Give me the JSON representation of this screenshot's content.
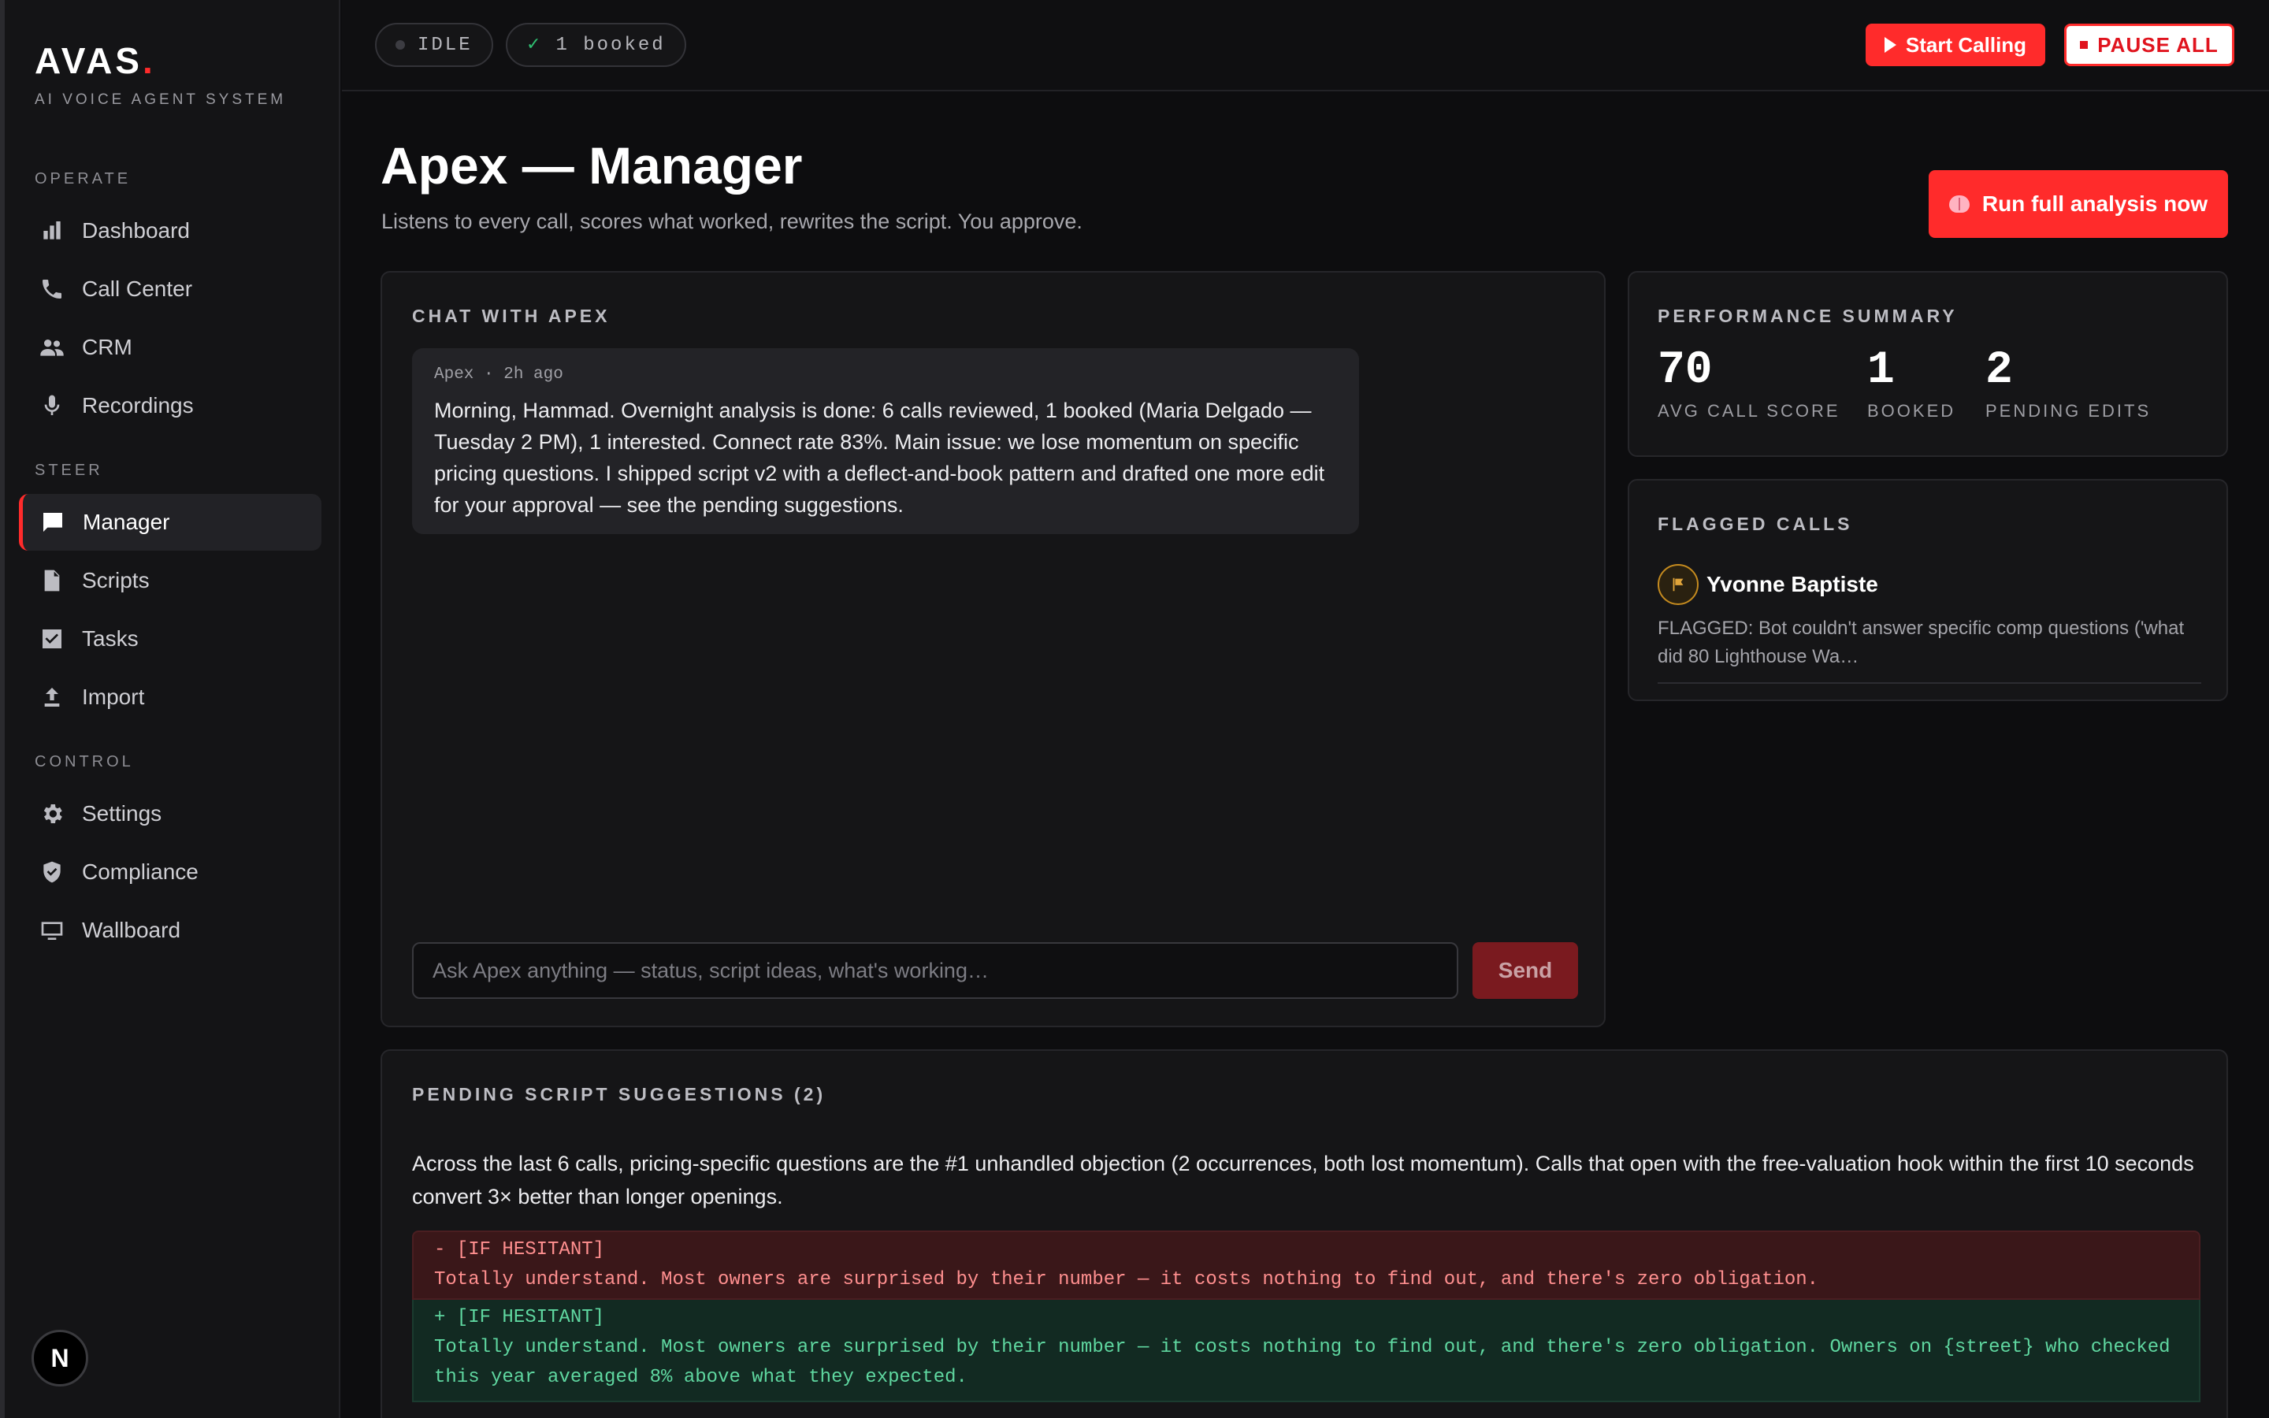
{
  "brand": {
    "name": "AVAS",
    "dot": ".",
    "subtitle": "AI VOICE AGENT SYSTEM"
  },
  "sidebar": {
    "sections": [
      {
        "heading": "OPERATE",
        "items": [
          {
            "label": "Dashboard",
            "icon": "bar-chart-icon"
          },
          {
            "label": "Call Center",
            "icon": "phone-icon"
          },
          {
            "label": "CRM",
            "icon": "people-icon"
          },
          {
            "label": "Recordings",
            "icon": "microphone-icon"
          }
        ]
      },
      {
        "heading": "STEER",
        "items": [
          {
            "label": "Manager",
            "icon": "chat-bubble-icon",
            "active": true
          },
          {
            "label": "Scripts",
            "icon": "document-icon"
          },
          {
            "label": "Tasks",
            "icon": "checkbox-icon"
          },
          {
            "label": "Import",
            "icon": "upload-icon"
          }
        ]
      },
      {
        "heading": "CONTROL",
        "items": [
          {
            "label": "Settings",
            "icon": "gear-icon"
          },
          {
            "label": "Compliance",
            "icon": "shield-check-icon"
          },
          {
            "label": "Wallboard",
            "icon": "monitor-icon"
          }
        ]
      }
    ],
    "badge": "N"
  },
  "topbar": {
    "status": "IDLE",
    "booked_check": "✓",
    "booked": "1 booked",
    "start_label": "Start Calling",
    "pause_label": "PAUSE ALL"
  },
  "header": {
    "title": "Apex — Manager",
    "subtitle": "Listens to every call, scores what worked, rewrites the script. You approve.",
    "analysis_label": "Run full analysis now"
  },
  "chat": {
    "title": "CHAT WITH APEX",
    "message": {
      "meta": "Apex · 2h ago",
      "text": "Morning, Hammad. Overnight analysis is done: 6 calls reviewed, 1 booked (Maria Delgado — Tuesday 2 PM), 1 interested. Connect rate 83%. Main issue: we lose momentum on specific pricing questions. I shipped script v2 with a deflect-and-book pattern and drafted one more edit for your approval — see the pending suggestions."
    },
    "input_placeholder": "Ask Apex anything — status, script ideas, what's working…",
    "send_label": "Send"
  },
  "performance": {
    "title": "PERFORMANCE SUMMARY",
    "stats": [
      {
        "value": "70",
        "label": "AVG CALL SCORE"
      },
      {
        "value": "1",
        "label": "BOOKED"
      },
      {
        "value": "2",
        "label": "PENDING EDITS"
      }
    ]
  },
  "flagged": {
    "title": "FLAGGED CALLS",
    "items": [
      {
        "name": "Yvonne Baptiste",
        "note": "FLAGGED: Bot couldn't answer specific comp questions ('what did 80 Lighthouse Wa…"
      }
    ]
  },
  "pending": {
    "title": "PENDING SCRIPT SUGGESTIONS (2)",
    "summary": "Across the last 6 calls, pricing-specific questions are the #1 unhandled objection (2 occurrences, both lost momentum). Calls that open with the free-valuation hook within the first 10 seconds convert 3× better than longer openings.",
    "diff_old": "- [IF HESITANT]\nTotally understand. Most owners are surprised by their number — it costs nothing to find out, and there's zero obligation.",
    "diff_new": "+ [IF HESITANT]\nTotally understand. Most owners are surprised by their number — it costs nothing to find out, and there's zero obligation. Owners on {street} who checked this year averaged 8% above what they expected."
  },
  "colors": {
    "accent": "#ff2b2b",
    "flag": "#e0a43a",
    "diff_removed": "#ff8f8f",
    "diff_added": "#5fd7a0"
  }
}
